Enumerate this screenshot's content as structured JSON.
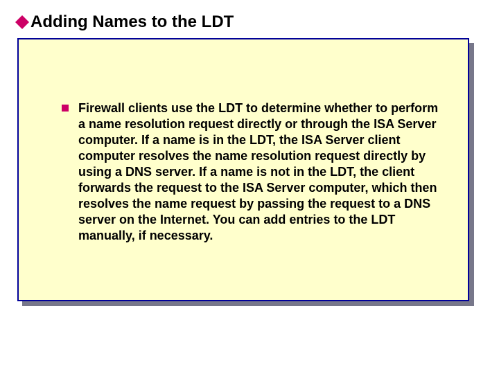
{
  "title": {
    "text": "Adding Names to the LDT",
    "bullet_color": "#cc0066"
  },
  "content_box": {
    "fill": "#ffffcc",
    "border": "#000099",
    "shadow": "#77778a"
  },
  "body": {
    "bullet_color": "#cc0066",
    "text": "Firewall clients use the LDT to determine whether to perform a name resolution request directly or through the ISA Server computer. If a name is in the LDT, the ISA Server client computer resolves the name resolution request directly by using a DNS server. If a name is not in the LDT, the client forwards the request to the ISA Server computer, which then resolves the name request by passing the request to a DNS server on the Internet. You can add entries to the LDT manually, if necessary."
  }
}
